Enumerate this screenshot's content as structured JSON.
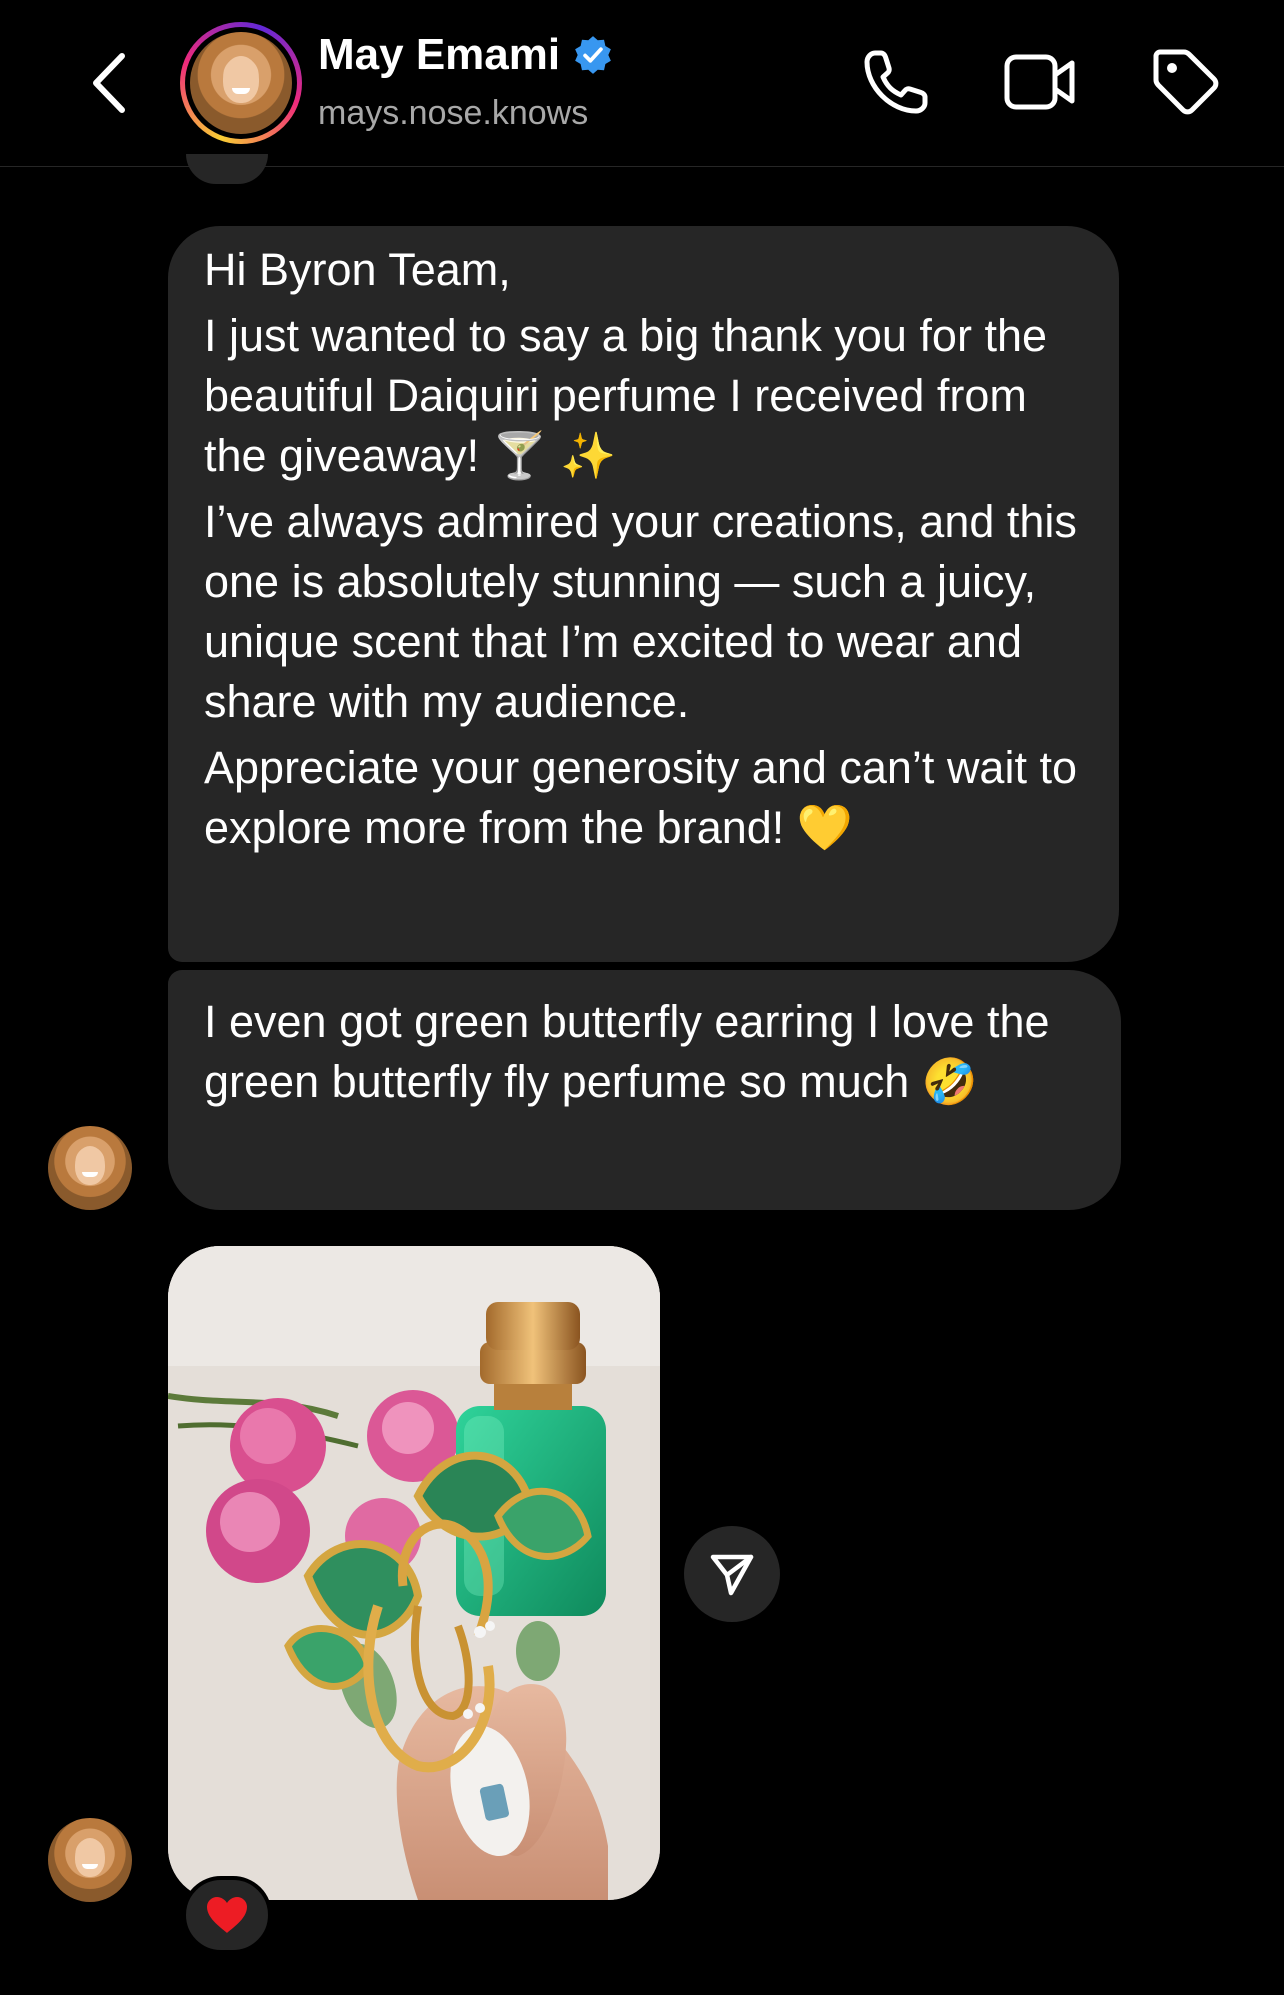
{
  "header": {
    "name": "May Emami",
    "username": "mays.nose.knows",
    "verified": true
  },
  "messages": [
    {
      "paragraphs": [
        "Hi Byron Team,",
        "I just wanted to say a big thank you for the beautiful Daiquiri perfume I received from the giveaway! 🍸 ✨",
        "I’ve always admired your creations, and this one is absolutely stunning — such a juicy, unique scent that I’m excited to wear and share with my audience.",
        "Appreciate your generosity and can’t wait to explore more from the brand! 💛"
      ]
    },
    {
      "text": "I even got green butterfly earring I love the green butterfly fly perfume so much 🤣"
    }
  ],
  "photo_message": {
    "reaction": "❤️"
  },
  "colors": {
    "background": "#000000",
    "bubble": "#262626",
    "username_gray": "#a8a8a8",
    "verified_blue": "#3897f0",
    "heart_red": "#ed1c24"
  },
  "icons": [
    "back-chevron-icon",
    "verified-badge-icon",
    "phone-icon",
    "video-camera-icon",
    "tag-icon",
    "send-icon",
    "heart-reaction-icon"
  ]
}
